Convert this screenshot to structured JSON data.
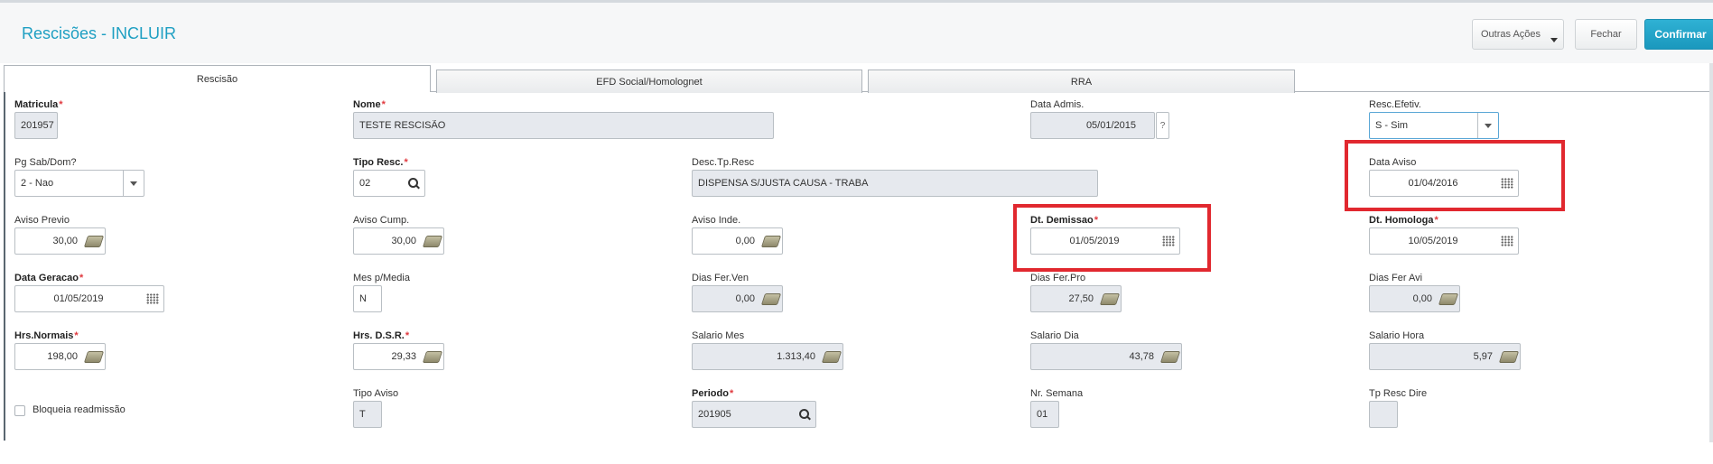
{
  "header": {
    "title": "Rescisões - INCLUIR",
    "buttons": {
      "outras": "Outras Ações",
      "fechar": "Fechar",
      "confirmar": "Confirmar"
    }
  },
  "tabs": [
    {
      "label": "Rescisão",
      "active": true
    },
    {
      "label": "EFD Social/Homolognet",
      "active": false
    },
    {
      "label": "RRA",
      "active": false
    }
  ],
  "fields": {
    "matricula": {
      "label": "Matricula",
      "value": "201957"
    },
    "nome": {
      "label": "Nome",
      "value": "TESTE RESCISÃO"
    },
    "data_admis": {
      "label": "Data Admis.",
      "value": "05/01/2015",
      "help": "?"
    },
    "resc_efetiv": {
      "label": "Resc.Efetiv.",
      "value": "S - Sim"
    },
    "pg_sab_dom": {
      "label": "Pg Sab/Dom?",
      "value": "2 - Nao"
    },
    "tipo_resc": {
      "label": "Tipo Resc.",
      "value": "02"
    },
    "desc_tp_resc": {
      "label": "Desc.Tp.Resc",
      "value": "DISPENSA S/JUSTA CAUSA - TRABA"
    },
    "data_aviso": {
      "label": "Data Aviso",
      "value": "01/04/2016"
    },
    "aviso_previo": {
      "label": "Aviso Previo",
      "value": "30,00"
    },
    "aviso_cump": {
      "label": "Aviso Cump.",
      "value": "30,00"
    },
    "aviso_inde": {
      "label": "Aviso Inde.",
      "value": "0,00"
    },
    "dt_demissao": {
      "label": "Dt. Demissao",
      "value": "01/05/2019"
    },
    "dt_homologa": {
      "label": "Dt. Homologa",
      "value": "10/05/2019"
    },
    "data_geracao": {
      "label": "Data Geracao",
      "value": "01/05/2019"
    },
    "mes_p_media": {
      "label": "Mes p/Media",
      "value": "N"
    },
    "dias_fer_ven": {
      "label": "Dias Fer.Ven",
      "value": "0,00"
    },
    "dias_fer_pro": {
      "label": "Dias Fer.Pro",
      "value": "27,50"
    },
    "dias_fer_avi": {
      "label": "Dias Fer Avi",
      "value": "0,00"
    },
    "hrs_normais": {
      "label": "Hrs.Normais",
      "value": "198,00"
    },
    "hrs_dsr": {
      "label": "Hrs. D.S.R.",
      "value": "29,33"
    },
    "salario_mes": {
      "label": "Salario Mes",
      "value": "1.313,40"
    },
    "salario_dia": {
      "label": "Salario Dia",
      "value": "43,78"
    },
    "salario_hora": {
      "label": "Salario Hora",
      "value": "5,97"
    },
    "bloqueia": {
      "label": "Bloqueia readmissão",
      "checked": false
    },
    "tipo_aviso": {
      "label": "Tipo Aviso",
      "value": "T"
    },
    "periodo": {
      "label": "Periodo",
      "value": "201905"
    },
    "nr_semana": {
      "label": "Nr. Semana",
      "value": "01"
    },
    "tp_resc_dire": {
      "label": "Tp Resc Dire",
      "value": ""
    }
  },
  "required_marker": "*",
  "colors": {
    "title": "#1e9fc2",
    "confirm": "#1a98bd",
    "highlight": "#e1282f",
    "readonly_bg": "#e6e9ee"
  }
}
